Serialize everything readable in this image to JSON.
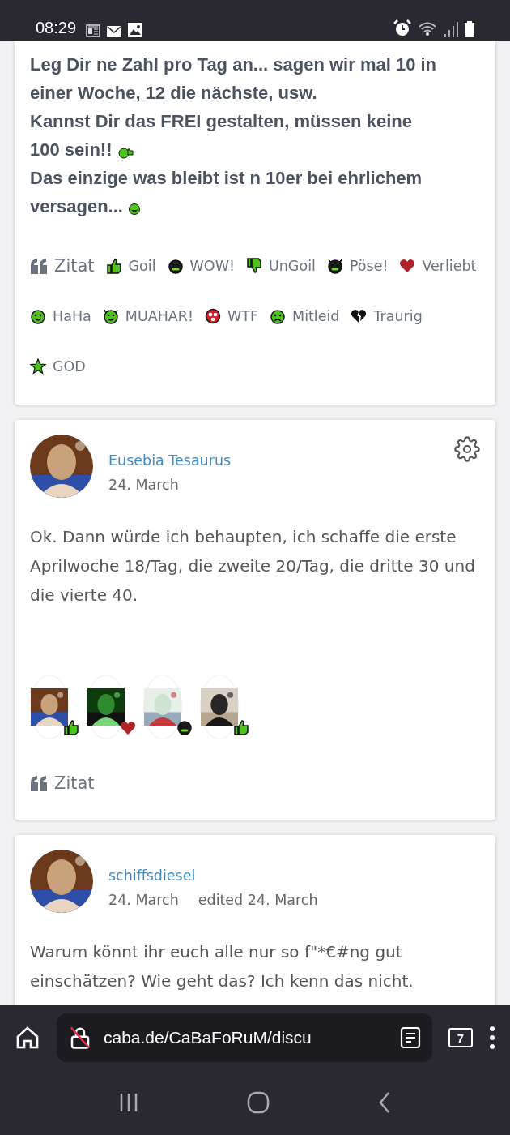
{
  "status_bar": {
    "time": "08:29"
  },
  "posts": [
    {
      "cut_top": true,
      "paragraphs": [
        {
          "lines": [
            "Leg Dir ne Zahl pro Tag an... sagen wir mal 10 in",
            "einer Woche, 12 die nächste, usw."
          ]
        },
        {
          "lines": [
            "Kannst Dir das FREI gestalten, müssen keine",
            "100 sein!!"
          ],
          "emoji": {
            "kind": "thumbs_smiley"
          }
        },
        {
          "lines": [
            "Das einzige was bleibt ist n 10er bei ehrlichem",
            "versagen..."
          ],
          "emoji": {
            "kind": "tongue_smiley"
          }
        }
      ],
      "bold": true,
      "actions": [
        {
          "kind": "quote",
          "label": "Zitat"
        },
        {
          "kind": "thumbs_up",
          "label": "Goil"
        },
        {
          "kind": "grin",
          "label": "WOW!"
        },
        {
          "kind": "thumbs_down",
          "label": "UnGoil"
        },
        {
          "kind": "devil",
          "label": "Pöse!"
        },
        {
          "kind": "heart",
          "label": "Verliebt"
        },
        {
          "kind": "smile",
          "label": "HaHa"
        },
        {
          "kind": "devil_grin",
          "label": "MUAHAR!"
        },
        {
          "kind": "wtf",
          "label": "WTF"
        },
        {
          "kind": "sad",
          "label": "Mitleid"
        },
        {
          "kind": "broken_heart",
          "label": "Traurig"
        },
        {
          "kind": "star",
          "label": "GOD"
        }
      ]
    },
    {
      "cut_top": false,
      "author": "Eusebia Tesaurus",
      "date": "24. March",
      "settings": true,
      "bold": false,
      "paragraphs": [
        {
          "text": "Ok. Dann würde ich behaupten, ich schaffe die erste Aprilwoche 18/Tag, die zweite 20/Tag, die dritte 30 und die vierte 40."
        }
      ],
      "reactors": [
        {
          "kind": "thumbs_up"
        },
        {
          "kind": "heart"
        },
        {
          "kind": "grin"
        },
        {
          "kind": "thumbs_up"
        }
      ],
      "actions": [
        {
          "kind": "quote",
          "label": "Zitat"
        }
      ]
    },
    {
      "cut_top": false,
      "author": "schiffsdiesel",
      "date": "24. March",
      "edited": "edited 24. March",
      "settings": false,
      "bold": false,
      "paragraphs": [
        {
          "text": "Warum könnt ihr euch alle nur so f\"*€#ng gut einschätzen? Wie geht das? Ich kenn das nicht."
        }
      ]
    }
  ],
  "browser": {
    "url": "caba.de/CaBaFoRuM/discu",
    "tab_count": "7"
  }
}
